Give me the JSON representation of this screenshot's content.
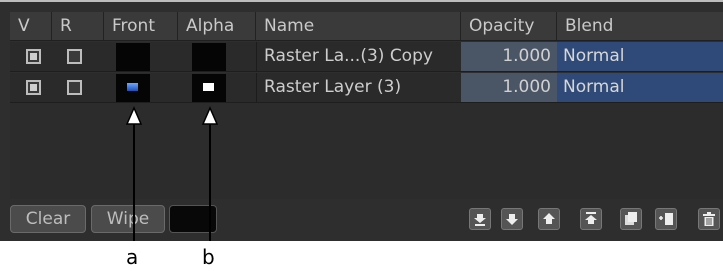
{
  "columns": [
    "V",
    "R",
    "Front",
    "Alpha",
    "Name",
    "Opacity",
    "Blend"
  ],
  "rows": [
    {
      "visible": true,
      "render": false,
      "name": "Raster La...(3) Copy",
      "opacity": "1.000",
      "blend": "Normal",
      "front_thumb": "none",
      "alpha_thumb": "none"
    },
    {
      "visible": true,
      "render": false,
      "name": "Raster Layer (3)",
      "opacity": "1.000",
      "blend": "Normal",
      "front_thumb": "blue",
      "alpha_thumb": "white"
    }
  ],
  "buttons": {
    "clear": "Clear",
    "wipe": "Wipe"
  },
  "toolbar_icons": [
    "move-to-bottom-icon",
    "move-down-icon",
    "move-up-icon",
    "move-to-top-icon",
    "duplicate-icon",
    "add-layer-icon",
    "delete-icon"
  ],
  "callouts": {
    "a": "a",
    "b": "b"
  },
  "colors": {
    "panel": "#2e2e2e",
    "opacity_bg": "#4a5566",
    "blend_bg": "#2f4a78",
    "front_thumb": "#2f6fd6",
    "alpha_thumb": "#ffffff"
  }
}
